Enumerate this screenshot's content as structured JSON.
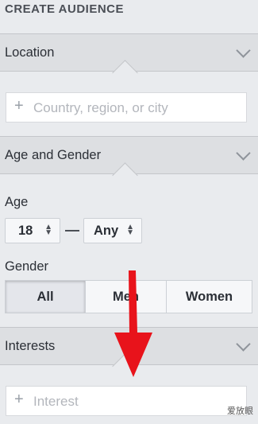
{
  "header": {
    "title": "CREATE AUDIENCE"
  },
  "location": {
    "title": "Location",
    "placeholder": "Country, region, or city"
  },
  "age_gender": {
    "title": "Age and Gender",
    "age_label": "Age",
    "age_min": "18",
    "age_max": "Any",
    "gender_label": "Gender",
    "gender_options": [
      "All",
      "Men",
      "Women"
    ],
    "gender_selected": "All"
  },
  "interests": {
    "title": "Interests",
    "placeholder": "Interest"
  },
  "annotation": {
    "arrow_color": "#e8131b"
  },
  "watermark": {
    "text": "爱放眼"
  },
  "colors": {
    "background": "#e9ebee",
    "header": "#dddfe2",
    "arrow": "#e8131b"
  }
}
